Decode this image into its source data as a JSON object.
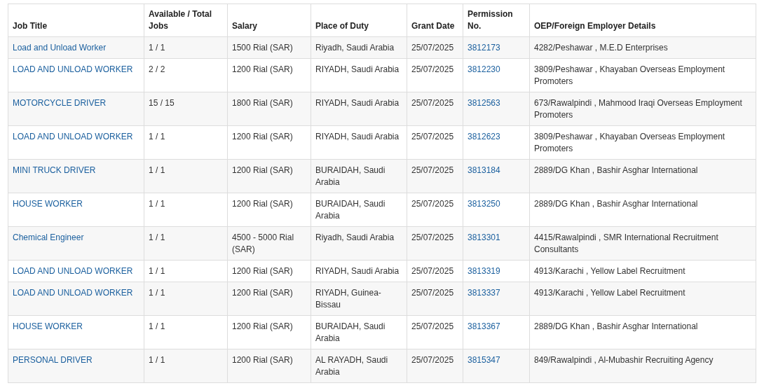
{
  "table": {
    "columns": [
      "Job Title",
      "Available / Total Jobs",
      "Salary",
      "Place of Duty",
      "Grant Date",
      "Permission No.",
      "OEP/Foreign Employer Details"
    ],
    "rows": [
      {
        "job_title": "Load and Unload Worker",
        "jobs": "1 / 1",
        "salary": "1500 Rial (SAR)",
        "place": "Riyadh, Saudi Arabia",
        "grant_date": "25/07/2025",
        "permission_no": "3812173",
        "employer": "4282/Peshawar , M.E.D Enterprises"
      },
      {
        "job_title": "LOAD AND UNLOAD WORKER",
        "jobs": "2 / 2",
        "salary": "1200 Rial (SAR)",
        "place": "RIYADH, Saudi Arabia",
        "grant_date": "25/07/2025",
        "permission_no": "3812230",
        "employer": "3809/Peshawar , Khayaban Overseas Employment Promoters"
      },
      {
        "job_title": "MOTORCYCLE DRIVER",
        "jobs": "15 / 15",
        "salary": "1800 Rial (SAR)",
        "place": "RIYADH, Saudi Arabia",
        "grant_date": "25/07/2025",
        "permission_no": "3812563",
        "employer": "673/Rawalpindi , Mahmood Iraqi Overseas Employment Promoters"
      },
      {
        "job_title": "LOAD AND UNLOAD WORKER",
        "jobs": "1 / 1",
        "salary": "1200 Rial (SAR)",
        "place": "RIYADH, Saudi Arabia",
        "grant_date": "25/07/2025",
        "permission_no": "3812623",
        "employer": "3809/Peshawar , Khayaban Overseas Employment Promoters"
      },
      {
        "job_title": "MINI TRUCK DRIVER",
        "jobs": "1 / 1",
        "salary": "1200 Rial (SAR)",
        "place": "BURAIDAH, Saudi Arabia",
        "grant_date": "25/07/2025",
        "permission_no": "3813184",
        "employer": "2889/DG Khan , Bashir Asghar International"
      },
      {
        "job_title": "HOUSE WORKER",
        "jobs": "1 / 1",
        "salary": "1200 Rial (SAR)",
        "place": "BURAIDAH, Saudi Arabia",
        "grant_date": "25/07/2025",
        "permission_no": "3813250",
        "employer": "2889/DG Khan , Bashir Asghar International"
      },
      {
        "job_title": "Chemical Engineer",
        "jobs": "1 / 1",
        "salary": "4500 - 5000 Rial (SAR)",
        "place": "Riyadh, Saudi Arabia",
        "grant_date": "25/07/2025",
        "permission_no": "3813301",
        "employer": "4415/Rawalpindi , SMR International Recruitment Consultants"
      },
      {
        "job_title": "LOAD AND UNLOAD WORKER",
        "jobs": "1 / 1",
        "salary": "1200 Rial (SAR)",
        "place": "RIYADH, Saudi Arabia",
        "grant_date": "25/07/2025",
        "permission_no": "3813319",
        "employer": "4913/Karachi , Yellow Label Recruitment"
      },
      {
        "job_title": "LOAD AND UNLOAD WORKER",
        "jobs": "1 / 1",
        "salary": "1200 Rial (SAR)",
        "place": "RIYADH, Guinea-Bissau",
        "grant_date": "25/07/2025",
        "permission_no": "3813337",
        "employer": "4913/Karachi , Yellow Label Recruitment"
      },
      {
        "job_title": "HOUSE WORKER",
        "jobs": "1 / 1",
        "salary": "1200 Rial (SAR)",
        "place": "BURAIDAH, Saudi Arabia",
        "grant_date": "25/07/2025",
        "permission_no": "3813367",
        "employer": "2889/DG Khan , Bashir Asghar International"
      },
      {
        "job_title": "PERSONAL DRIVER",
        "jobs": "1 / 1",
        "salary": "1200 Rial (SAR)",
        "place": "AL RAYADH, Saudi Arabia",
        "grant_date": "25/07/2025",
        "permission_no": "3815347",
        "employer": "849/Rawalpindi , Al-Mubashir Recruiting Agency"
      }
    ]
  }
}
